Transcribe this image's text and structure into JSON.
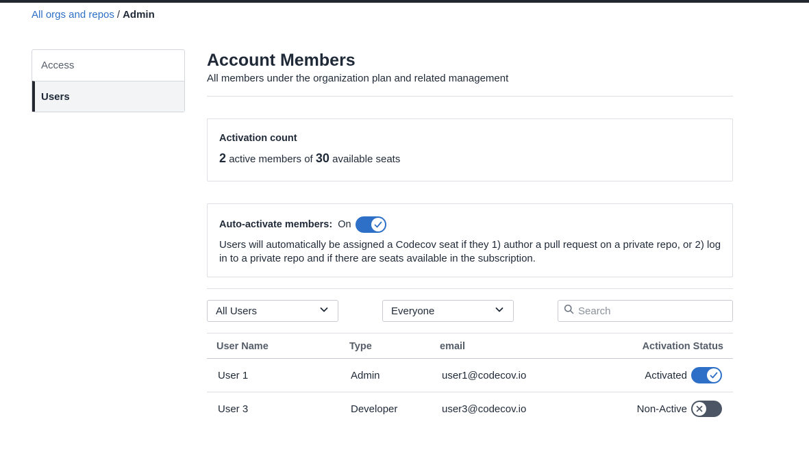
{
  "breadcrumb": {
    "link": "All orgs and repos",
    "separator": "/",
    "current": "Admin"
  },
  "sidebar": {
    "items": [
      {
        "label": "Access"
      },
      {
        "label": "Users"
      }
    ]
  },
  "header": {
    "title": "Account Members",
    "subtitle": "All members under the organization plan and related management"
  },
  "activation": {
    "title": "Activation count",
    "active_count": "2",
    "text_mid": "active members of",
    "total_seats": "30",
    "text_end": "available seats"
  },
  "auto_activate": {
    "label": "Auto-activate members:",
    "state": "On",
    "enabled": true,
    "description": "Users will automatically be assigned a Codecov seat if they 1) author a pull request on a private repo, or 2) log in to a private repo and if there are seats available in the subscription."
  },
  "filters": {
    "users_select": "All Users",
    "role_select": "Everyone",
    "search_placeholder": "Search"
  },
  "table": {
    "headers": {
      "name": "User Name",
      "type": "Type",
      "email": "email",
      "status": "Activation Status"
    },
    "rows": [
      {
        "name": "User 1",
        "type": "Admin",
        "email": "user1@codecov.io",
        "status": "Activated",
        "active": true
      },
      {
        "name": "User 3",
        "type": "Developer",
        "email": "user3@codecov.io",
        "status": "Non-Active",
        "active": false
      }
    ]
  },
  "colors": {
    "accent": "#2e6fc7",
    "toggle_off": "#4b5563",
    "topbar": "#23272f"
  },
  "icons": {
    "dropdown": "chevron-down-icon",
    "search": "search-icon",
    "on": "check-icon",
    "off": "x-icon"
  }
}
